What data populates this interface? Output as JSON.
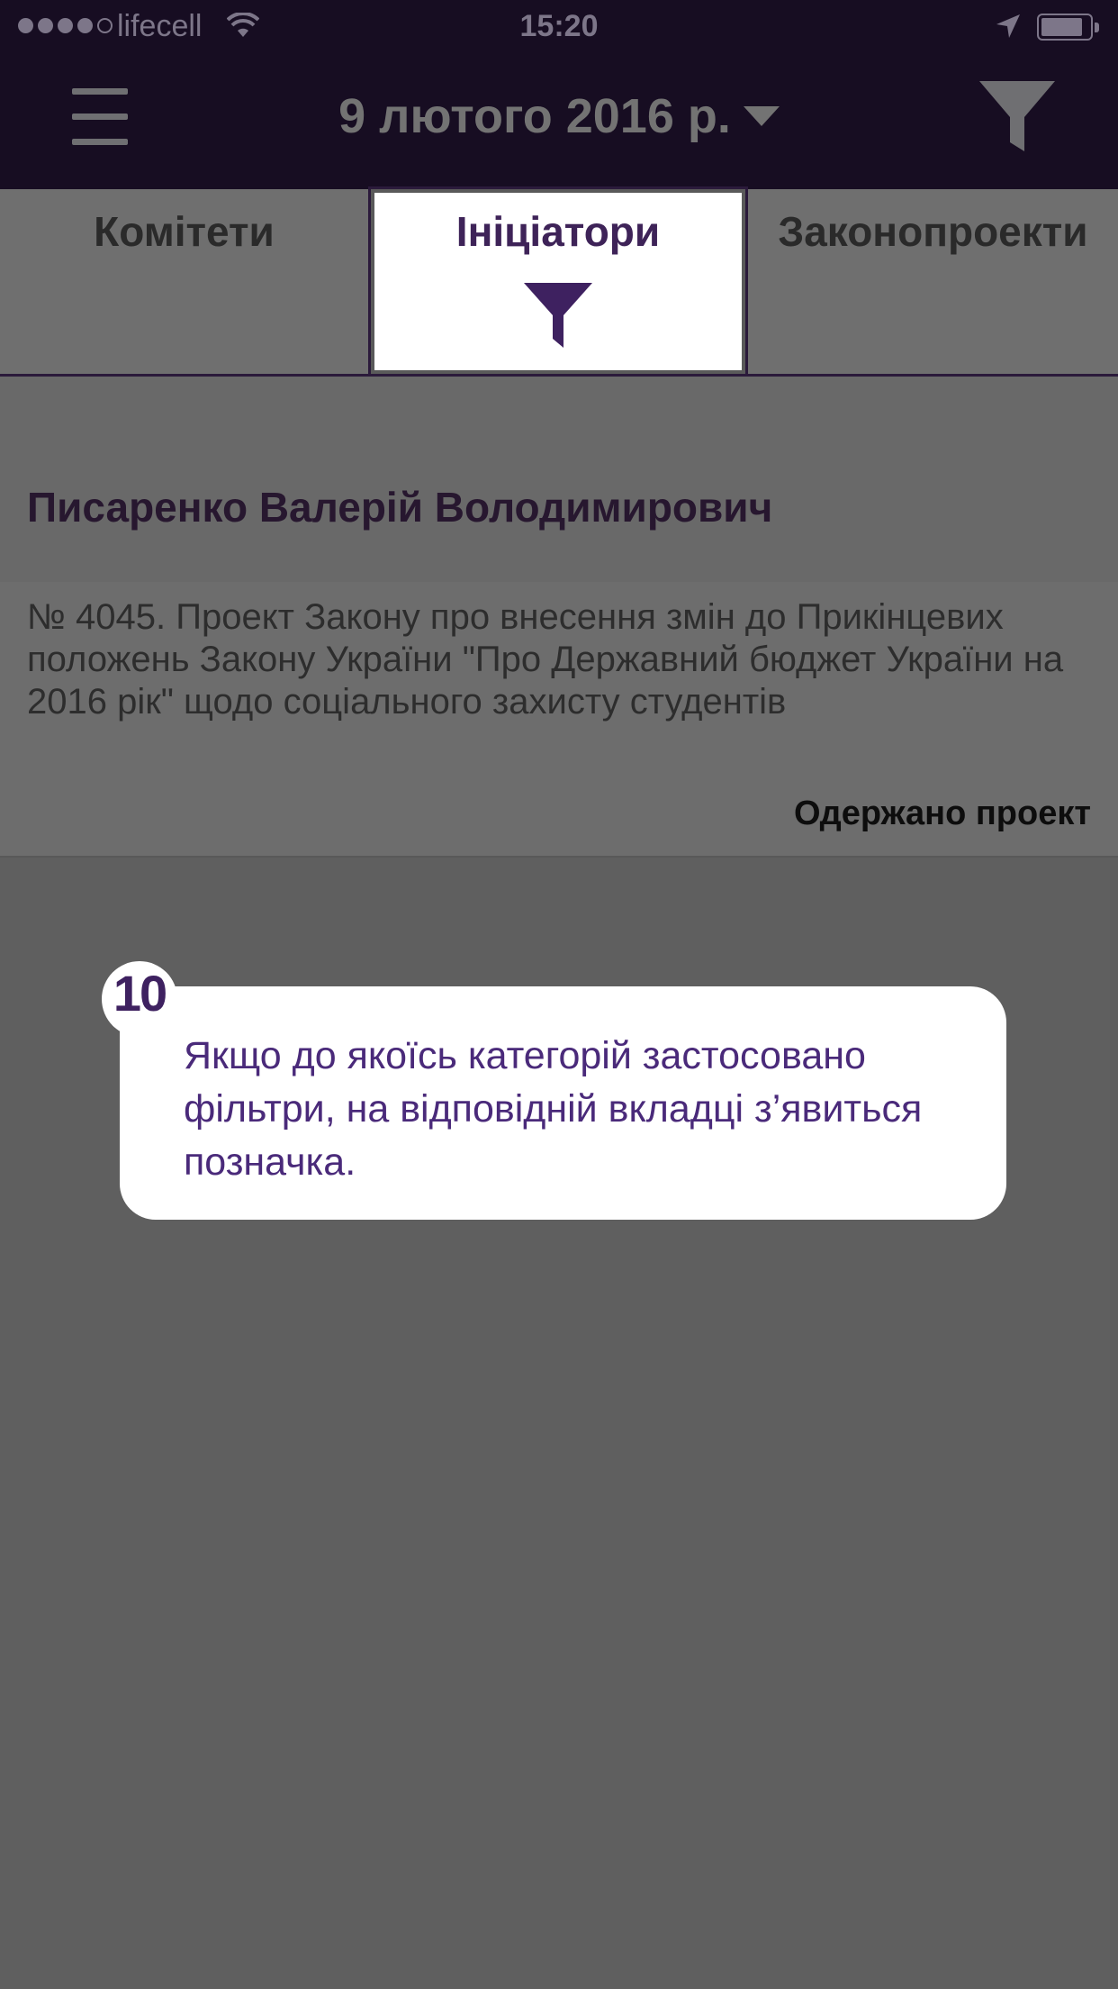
{
  "status_bar": {
    "carrier": "lifecell",
    "time": "15:20"
  },
  "nav": {
    "date": "9 лютого 2016 р."
  },
  "tabs": [
    {
      "label": "Комітети",
      "active": false,
      "filtered": false
    },
    {
      "label": "Ініціатори",
      "active": true,
      "filtered": true
    },
    {
      "label": "Законопроекти",
      "active": false,
      "filtered": false
    }
  ],
  "list": {
    "initiator": "Писаренко Валерій Володимирович",
    "bill": {
      "text": "№ 4045. Проект Закону про внесення змін до Прикінцевих положень Закону України \"Про Державний бюджет України на 2016 рік\" щодо соціального захисту студентів",
      "status": "Одержано проект"
    }
  },
  "tooltip": {
    "number": "10",
    "text": "Якщо до якоїсь категорій застосовано фільтри, на відповідній вкладці з’явиться позначка."
  },
  "colors": {
    "navbar_bg": "#170d22",
    "accent_purple": "#3e2358",
    "overlay_grey": "#5f5f5f"
  }
}
